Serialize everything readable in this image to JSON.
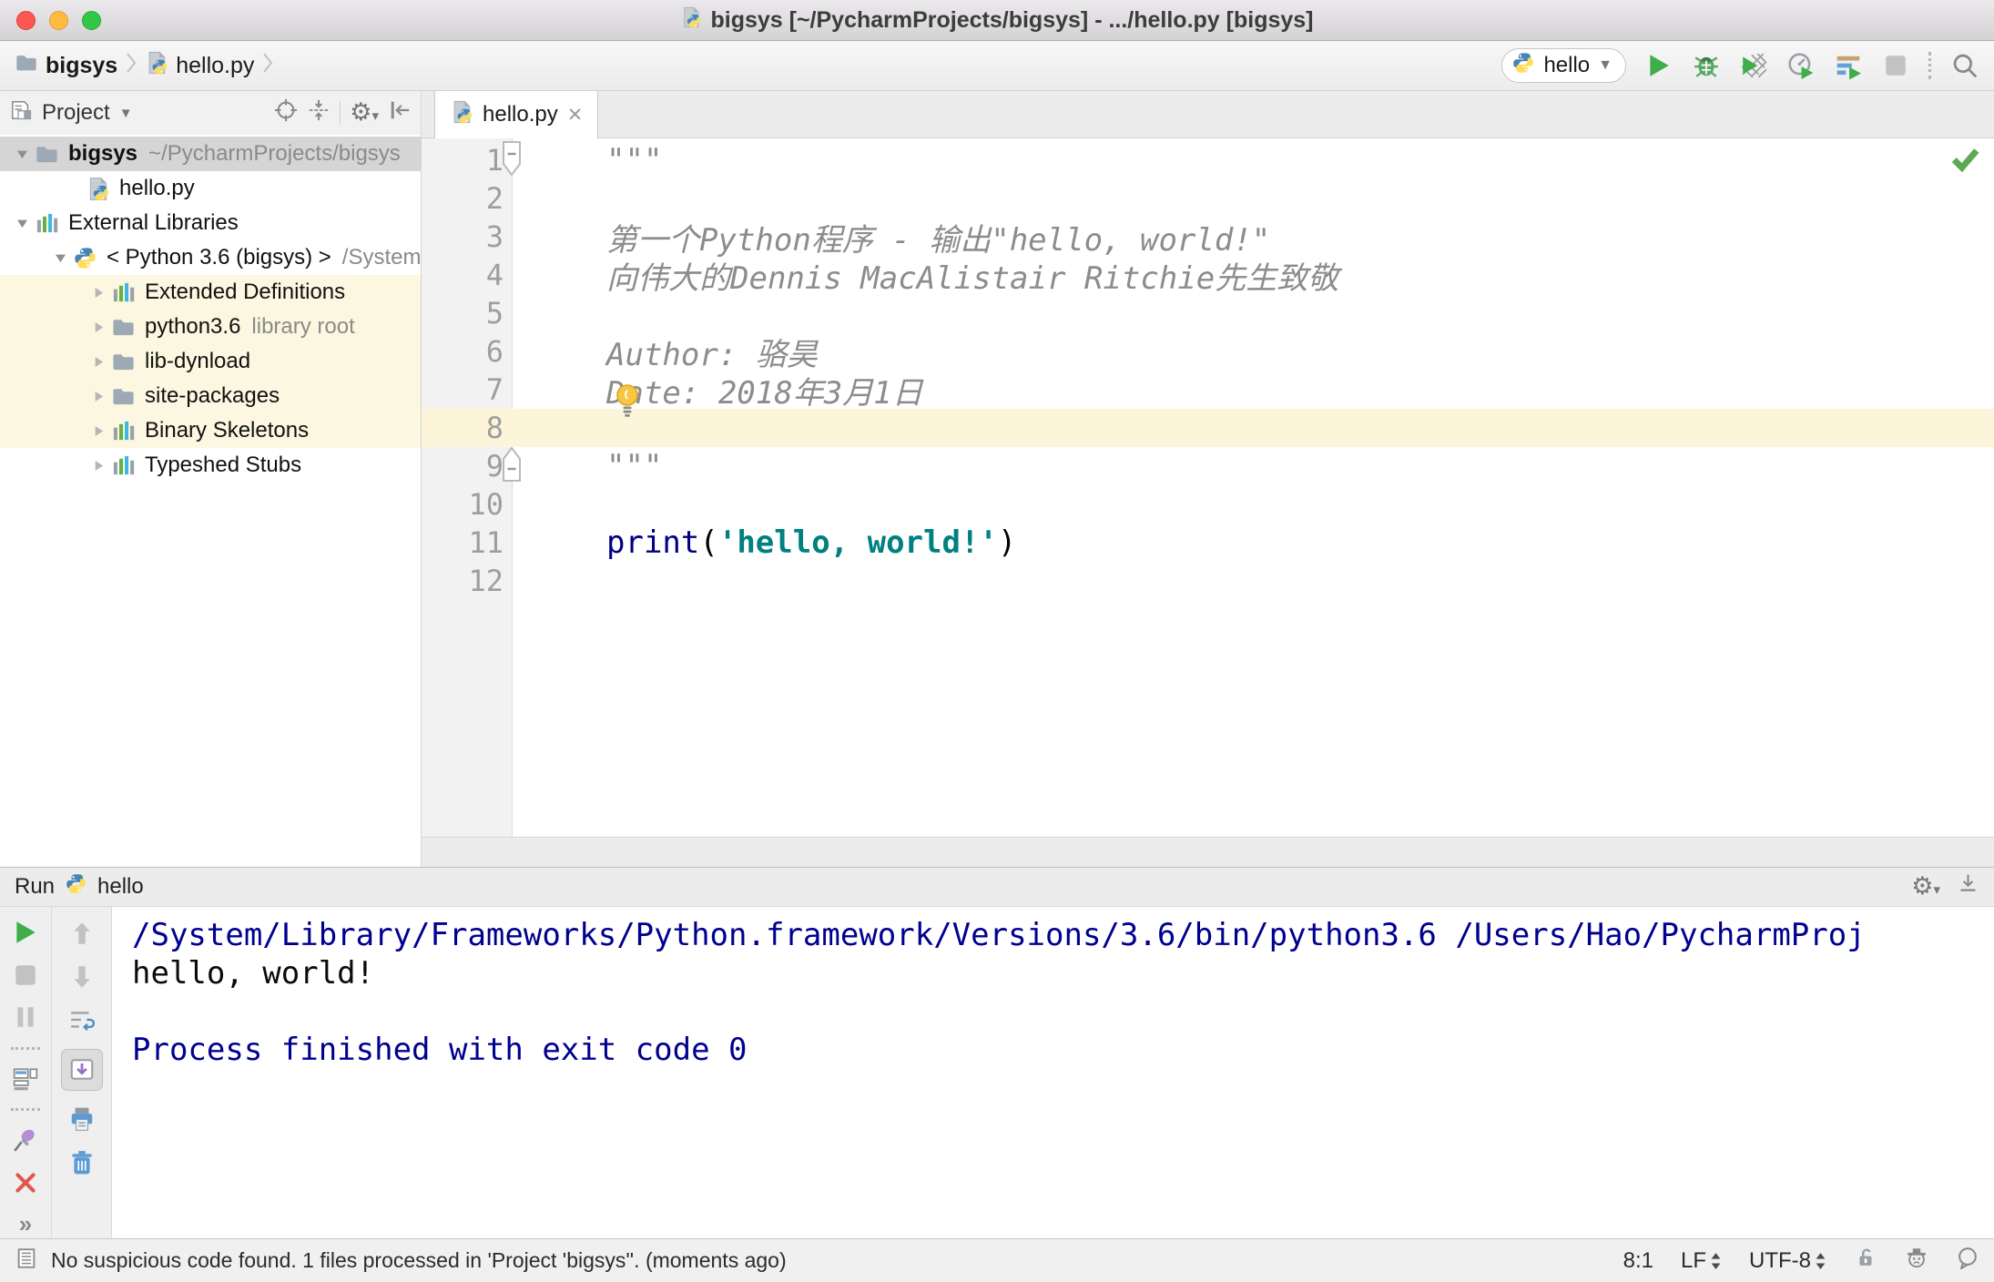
{
  "window": {
    "title": "bigsys [~/PycharmProjects/bigsys] - .../hello.py [bigsys]"
  },
  "navbar": {
    "breadcrumbs": [
      {
        "label": "bigsys",
        "icon": "folder"
      },
      {
        "label": "hello.py",
        "icon": "python-file"
      }
    ],
    "run_config": {
      "label": "hello"
    }
  },
  "project_panel": {
    "title": "Project",
    "tree": [
      {
        "label": "bigsys",
        "suffix": "~/PycharmProjects/bigsys",
        "icon": "folder",
        "expander": "open",
        "indent": 0,
        "selected": true,
        "bold": true
      },
      {
        "label": "hello.py",
        "icon": "python-file",
        "indent": 2
      },
      {
        "label": "External Libraries",
        "icon": "library",
        "expander": "open",
        "indent": 0
      },
      {
        "label": "< Python 3.6 (bigsys) >",
        "suffix": "/System",
        "icon": "python",
        "expander": "open",
        "indent": 1
      },
      {
        "label": "Extended Definitions",
        "icon": "library",
        "expander": "closed",
        "indent": 2,
        "highlight": true
      },
      {
        "label": "python3.6",
        "suffix": "library root",
        "icon": "folder",
        "expander": "closed",
        "indent": 2,
        "highlight": true
      },
      {
        "label": "lib-dynload",
        "icon": "folder",
        "expander": "closed",
        "indent": 2,
        "highlight": true
      },
      {
        "label": "site-packages",
        "icon": "folder",
        "expander": "closed",
        "indent": 2,
        "highlight": true
      },
      {
        "label": "Binary Skeletons",
        "icon": "library",
        "expander": "closed",
        "indent": 2,
        "highlight": true
      },
      {
        "label": "Typeshed Stubs",
        "icon": "library",
        "expander": "closed",
        "indent": 2
      }
    ]
  },
  "editor": {
    "tab": "hello.py",
    "lines": [
      {
        "n": "1",
        "fold": "start",
        "segments": [
          {
            "t": "\"\"\"",
            "c": "comment"
          }
        ]
      },
      {
        "n": "2",
        "segments": []
      },
      {
        "n": "3",
        "segments": [
          {
            "t": "第一个Python程序 - 输出\"hello, world!\"",
            "c": "comment"
          }
        ]
      },
      {
        "n": "4",
        "segments": [
          {
            "t": "向伟大的Dennis MacAlistair Ritchie先生致敬",
            "c": "comment"
          }
        ]
      },
      {
        "n": "5",
        "segments": []
      },
      {
        "n": "6",
        "segments": [
          {
            "t": "Author: 骆昊",
            "c": "comment"
          }
        ]
      },
      {
        "n": "7",
        "bulb": true,
        "segments": [
          {
            "t": "Date: 2018年3月1日",
            "c": "comment"
          }
        ]
      },
      {
        "n": "8",
        "caret_line": true,
        "segments": []
      },
      {
        "n": "9",
        "fold": "end",
        "segments": [
          {
            "t": "\"\"\"",
            "c": "comment"
          }
        ]
      },
      {
        "n": "10",
        "segments": []
      },
      {
        "n": "11",
        "segments": [
          {
            "t": "print",
            "c": "keyword"
          },
          {
            "t": "(",
            "c": "plain"
          },
          {
            "t": "'hello, world!'",
            "c": "string"
          },
          {
            "t": ")",
            "c": "plain"
          }
        ]
      },
      {
        "n": "12",
        "segments": []
      }
    ]
  },
  "run_panel": {
    "title": "Run",
    "config": "hello",
    "console": [
      {
        "text": "/System/Library/Frameworks/Python.framework/Versions/3.6/bin/python3.6 /Users/Hao/PycharmProj",
        "color": "system"
      },
      {
        "text": "hello, world!",
        "color": "stdout"
      },
      {
        "text": "",
        "color": "stdout"
      },
      {
        "text": "Process finished with exit code 0",
        "color": "system"
      }
    ]
  },
  "status_bar": {
    "message": "No suspicious code found. 1 files processed in 'Project 'bigsys''. (moments ago)",
    "caret_position": "8:1",
    "line_ending": "LF",
    "encoding": "UTF-8"
  }
}
